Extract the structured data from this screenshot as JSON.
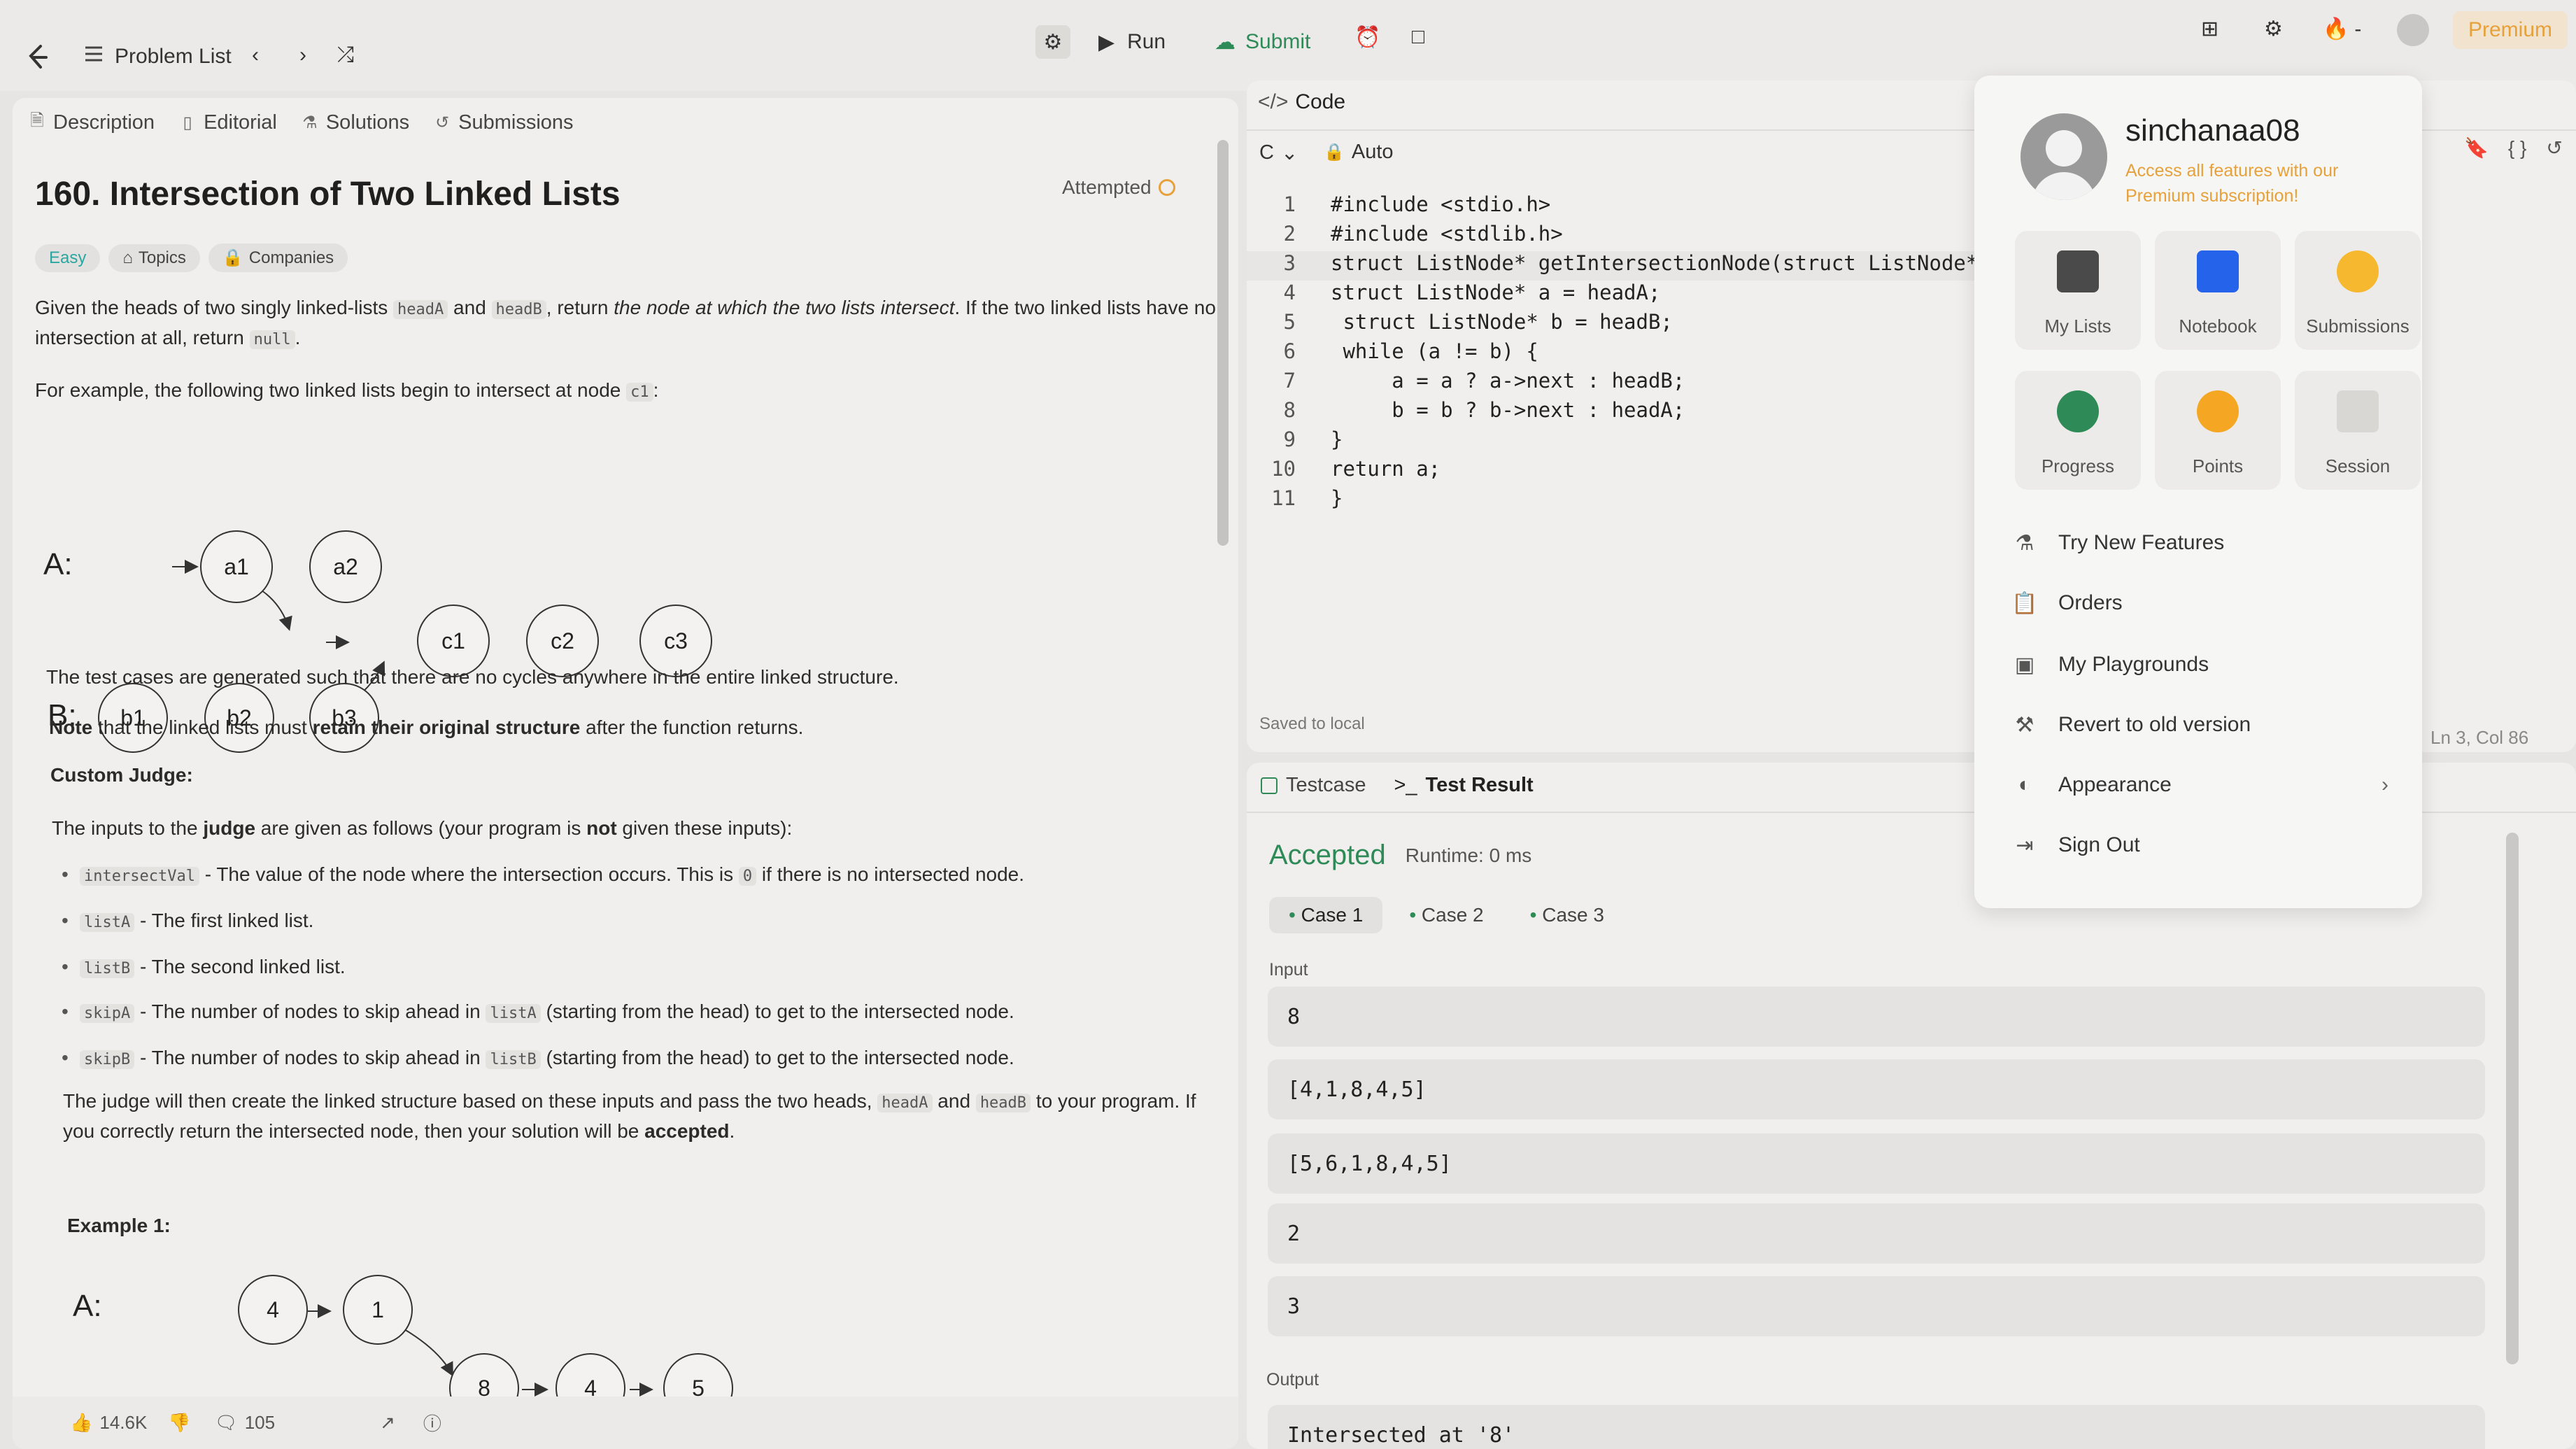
{
  "topbar": {
    "problem_list": "Problem List",
    "run": "Run",
    "submit": "Submit",
    "premium": "Premium"
  },
  "left": {
    "tabs": [
      "Description",
      "Editorial",
      "Solutions",
      "Submissions"
    ],
    "title": "160. Intersection of Two Linked Lists",
    "status": "Attempted",
    "chips": [
      "Easy",
      "Topics",
      "Companies"
    ],
    "desc_1a": "Given the heads of two singly linked-lists ",
    "desc_code_a": "headA",
    "desc_and": " and ",
    "desc_code_b": "headB",
    "desc_1b": ", return ",
    "desc_em": "the node at which the two lists intersect",
    "desc_1c": ". If the two linked lists have no intersection at all, return ",
    "desc_null": "null",
    "desc_1d": ".",
    "example_intro": "For example, the following two linked lists begin to intersect at node ",
    "example_node": "c1",
    "example_intro_end": ":",
    "diagram1": {
      "label_a": "A:",
      "label_b": "B:",
      "a_nodes": [
        "a1",
        "a2"
      ],
      "shared": [
        "c1",
        "c2",
        "c3"
      ],
      "b_nodes": [
        "b1",
        "b2",
        "b3"
      ]
    },
    "p_cycles": "The test cases are generated such that there are no cycles anywhere in the entire linked structure.",
    "p_note_bold": "Note",
    "p_note_mid": " that the linked lists must ",
    "p_note_bold2": "retain their original structure",
    "p_note_end": " after the function returns.",
    "custom_judge": "Custom Judge:",
    "p_judge_a": "The inputs to the ",
    "p_judge_bold": "judge",
    "p_judge_b": " are given as follows (your program is ",
    "p_judge_not": "not",
    "p_judge_c": " given these inputs):",
    "bullets": [
      {
        "code": "intersectVal",
        "text": " - The value of the node where the intersection occurs. This is ",
        "code2": "0",
        "text2": " if there is no intersected node."
      },
      {
        "code": "listA",
        "text": " - The first linked list.",
        "code2": "",
        "text2": ""
      },
      {
        "code": "listB",
        "text": " - The second linked list.",
        "code2": "",
        "text2": ""
      },
      {
        "code": "skipA",
        "text": " - The number of nodes to skip ahead in ",
        "code2": "listA",
        "text2": " (starting from the head) to get to the intersected node."
      },
      {
        "code": "skipB",
        "text": " - The number of nodes to skip ahead in ",
        "code2": "listB",
        "text2": " (starting from the head) to get to the intersected node."
      }
    ],
    "p_final_a": "The judge will then create the linked structure based on these inputs and pass the two heads, ",
    "p_final_code_a": "headA",
    "p_final_and": " and ",
    "p_final_code_b": "headB",
    "p_final_b": " to your program. If you correctly return the intersected node, then your solution will be ",
    "p_final_bold": "accepted",
    "p_final_end": ".",
    "example1": "Example 1:",
    "diagram2": {
      "label_a": "A:",
      "a_nodes": [
        "4",
        "1"
      ],
      "shared": [
        "8",
        "4",
        "5"
      ]
    },
    "likes": "14.6K",
    "comments": "105"
  },
  "code": {
    "header": "Code",
    "language": "C",
    "mode": "Auto",
    "saved": "Saved to local",
    "cursor": "Ln 3, Col 86",
    "lines": [
      "#include <stdio.h>",
      "#include <stdlib.h>",
      "struct ListNode* getIntersectionNode(struct ListNode* hea",
      "struct ListNode* a = headA;",
      " struct ListNode* b = headB;",
      " while (a != b) {",
      "     a = a ? a->next : headB;",
      "     b = b ? b->next : headA;",
      "}",
      "return a;",
      "}"
    ]
  },
  "test": {
    "tab_testcase": "Testcase",
    "tab_result": "Test Result",
    "verdict": "Accepted",
    "runtime": "Runtime: 0 ms",
    "cases": [
      "Case 1",
      "Case 2",
      "Case 3"
    ],
    "input_label": "Input",
    "inputs": [
      "8",
      "[4,1,8,4,5]",
      "[5,6,1,8,4,5]",
      "2",
      "3"
    ],
    "output_label": "Output",
    "output": "Intersected at '8'"
  },
  "menu": {
    "username": "sinchanaa08",
    "premium_note_1": "Access all features with our",
    "premium_note_2": "Premium subscription!",
    "tiles": [
      "My Lists",
      "Notebook",
      "Submissions",
      "Progress",
      "Points",
      "Session"
    ],
    "items": [
      "Try New Features",
      "Orders",
      "My Playgrounds",
      "Revert to old version",
      "Appearance",
      "Sign Out"
    ]
  },
  "colors": {
    "accent_green": "#2e8b57",
    "premium_orange": "#e7a13a",
    "accepted_green": "#2e8b57"
  }
}
